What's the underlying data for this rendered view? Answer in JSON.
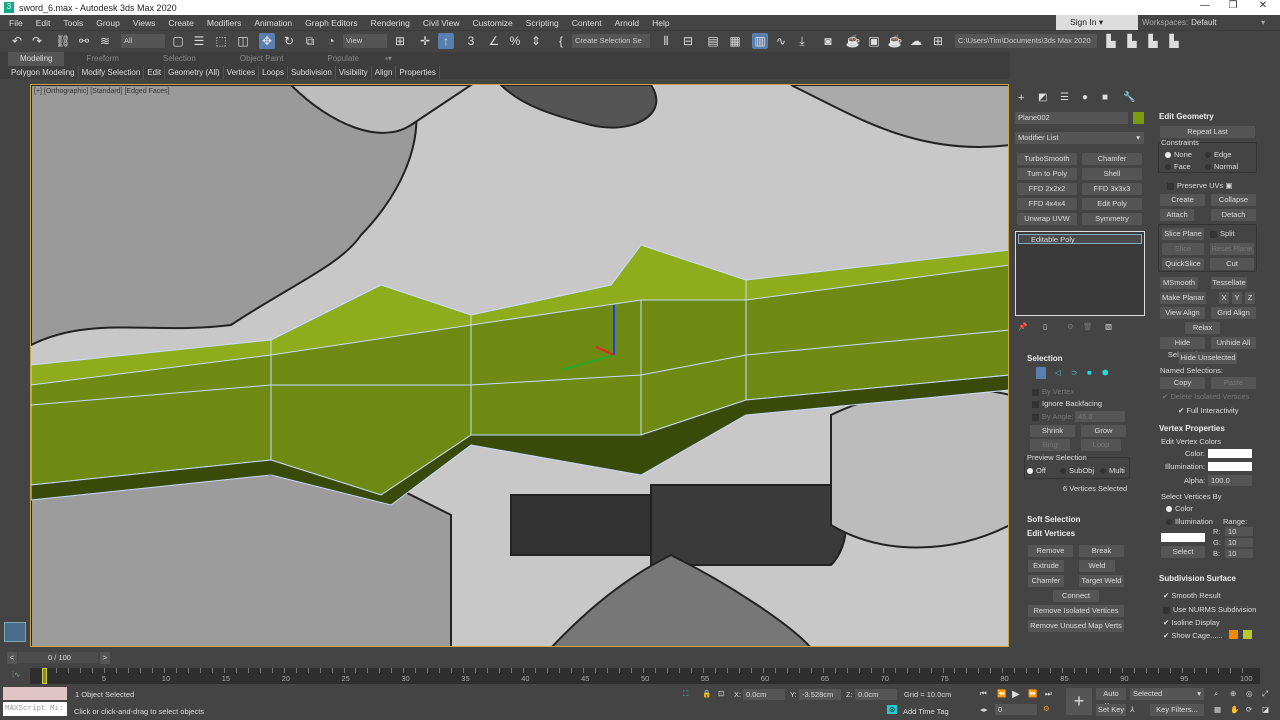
{
  "window": {
    "title": "sword_6.max - Autodesk 3ds Max 2020",
    "minimize": "—",
    "restore": "❐",
    "close": "✕"
  },
  "menu": [
    "File",
    "Edit",
    "Tools",
    "Group",
    "Views",
    "Create",
    "Modifiers",
    "Animation",
    "Graph Editors",
    "Rendering",
    "Civil View",
    "Customize",
    "Scripting",
    "Content",
    "Arnold",
    "Help"
  ],
  "account": {
    "sign_in": "Sign In",
    "workspaces_label": "Workspaces:",
    "workspace": "Default"
  },
  "toolbar": {
    "filter": "All",
    "ref_coord": "View",
    "selection_set": "Create Selection Se",
    "project_path": "C:\\Users\\Tim\\Documents\\3ds Max 2020"
  },
  "ribbon": {
    "tabs": [
      "Modeling",
      "Freeform",
      "Selection",
      "Object Paint",
      "Populate"
    ],
    "subtabs": [
      "Polygon Modeling",
      "Modify Selection",
      "Edit",
      "Geometry (All)",
      "Vertices",
      "Loops",
      "Subdivision",
      "Visibility",
      "Align",
      "Properties"
    ]
  },
  "viewport": {
    "label": "[+] [Orthographic] [Standard] [Edged Faces]"
  },
  "command_panel": {
    "object_name": "Plane002",
    "object_color": "#7a9a10",
    "modifier_list": "Modifier List",
    "modifier_buttons": [
      "TurboSmooth",
      "Chamfer",
      "Turn to Poly",
      "Shell",
      "FFD 2x2x2",
      "FFD 3x3x3",
      "FFD 4x4x4",
      "Edit Poly",
      "Unwrap UVW",
      "Symmetry"
    ],
    "stack": [
      "Editable Poly"
    ],
    "selection": {
      "title": "Selection",
      "by_vertex": "By Vertex",
      "ignore_backfacing": "Ignore Backfacing",
      "by_angle": "By Angle:",
      "angle": "45.0",
      "shrink": "Shrink",
      "grow": "Grow",
      "ring": "Ring",
      "loop": "Loop",
      "preview": "Preview Selection",
      "preview_options": [
        "Off",
        "SubObj",
        "Multi"
      ],
      "status": "6 Vertices Selected"
    },
    "soft_selection": "Soft Selection",
    "edit_vertices": {
      "title": "Edit Vertices",
      "buttons": [
        "Remove",
        "Break",
        "Extrude",
        "Weld",
        "Chamfer",
        "Target Weld",
        "Connect",
        "Remove Isolated Vertices",
        "Remove Unused Map Verts"
      ]
    },
    "edit_geometry": {
      "title": "Edit Geometry",
      "repeat_last": "Repeat Last",
      "constraints": "Constraints",
      "constraint_options": [
        "None",
        "Edge",
        "Face",
        "Normal"
      ],
      "preserve_uvs": "Preserve UVs",
      "create": "Create",
      "collapse": "Collapse",
      "attach": "Attach",
      "detach": "Detach",
      "slice_plane": "Slice Plane",
      "split": "Split",
      "slice": "Slice",
      "reset_plane": "Reset Plane",
      "quickslice": "QuickSlice",
      "cut": "Cut",
      "msmooth": "MSmooth",
      "tessellate": "Tessellate",
      "make_planar": "Make Planar",
      "x": "X",
      "y": "Y",
      "z": "Z",
      "view_align": "View Align",
      "grid_align": "Grid Align",
      "relax": "Relax",
      "hide_selected": "Hide Selected",
      "unhide_all": "Unhide All",
      "hide_unselected": "Hide Unselected",
      "named_selections": "Named Selections:",
      "copy": "Copy",
      "paste": "Paste",
      "delete_isolated": "Delete Isolated Vertices",
      "full_interactivity": "Full Interactivity"
    },
    "vertex_properties": {
      "title": "Vertex Properties",
      "edit_colors": "Edit Vertex Colors",
      "color": "Color:",
      "illumination": "Illumination:",
      "alpha_label": "Alpha:",
      "alpha": "100.0",
      "select_by": "Select Vertices By",
      "by_color": "Color",
      "by_illum": "Illumination",
      "range": "Range:",
      "r_label": "R:",
      "g_label": "G:",
      "b_label": "B:",
      "r": "10",
      "g": "10",
      "b": "10",
      "select": "Select"
    },
    "subdivision": {
      "title": "Subdivision Surface",
      "smooth_result": "Smooth Result",
      "use_nurms": "Use NURMS Subdivision",
      "isoline": "Isoline Display",
      "show_cage": "Show Cage......",
      "cage_colors": [
        "#f08a00",
        "#b8c830"
      ]
    }
  },
  "timeline": {
    "frame": "0 / 100",
    "ticks": [
      "0",
      "5",
      "10",
      "15",
      "20",
      "25",
      "30",
      "35",
      "40",
      "45",
      "50",
      "55",
      "60",
      "65",
      "70",
      "75",
      "80",
      "85",
      "90",
      "95",
      "100"
    ]
  },
  "status": {
    "maxscript": "MAXScript Mi:",
    "selected": "1 Object Selected",
    "prompt": "Click or click-and-drag to select objects",
    "x_label": "X:",
    "x": "0.0cm",
    "y_label": "Y:",
    "y": "-3.528cm",
    "z_label": "Z:",
    "z": "0.0cm",
    "grid": "Grid = 10.0cm",
    "add_time_tag": "Add Time Tag",
    "frame": "0",
    "auto_key": "Auto Key",
    "set_key": "Set Key",
    "key_mode": "Selected",
    "key_filters": "Key Filters..."
  }
}
